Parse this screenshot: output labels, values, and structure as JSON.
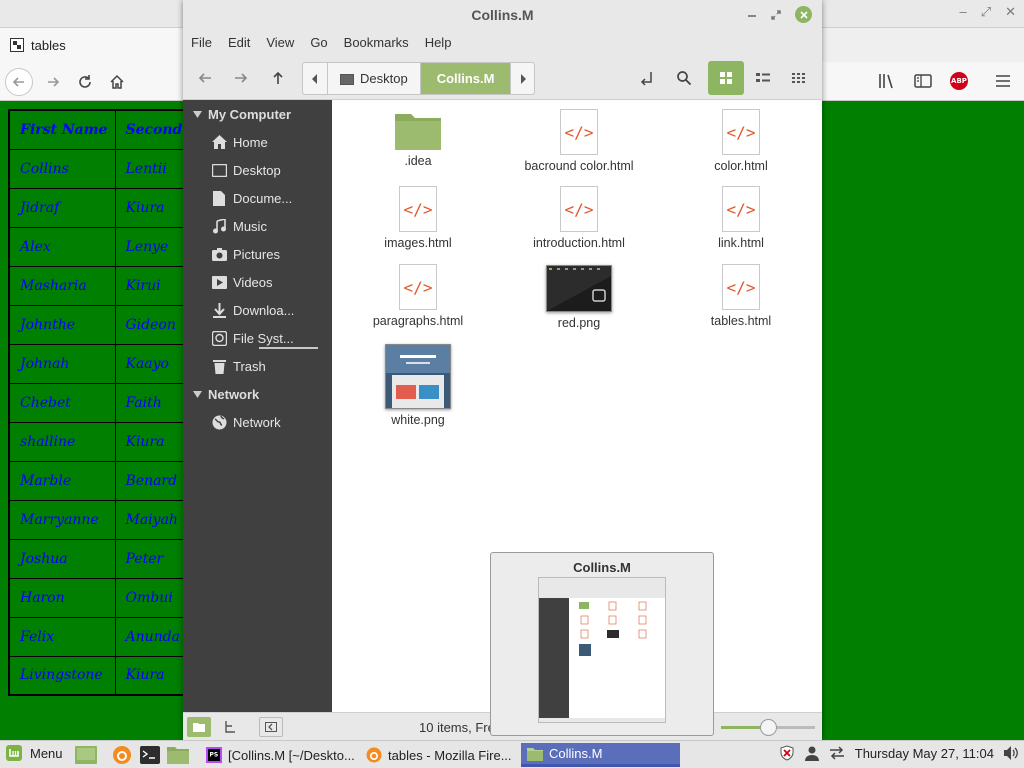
{
  "firefox": {
    "tab_title": "tables",
    "window_controls": [
      "–",
      "⤢",
      "✕"
    ],
    "table": {
      "headers": [
        "First Name",
        "Second"
      ],
      "rows": [
        [
          "Collins",
          "Lentii"
        ],
        [
          "Jidraf",
          "Kiura"
        ],
        [
          "Alex",
          "Lenye"
        ],
        [
          "Masharia",
          "Kirui"
        ],
        [
          "Johnthe",
          "Gideon"
        ],
        [
          "Johnah",
          "Kaayo"
        ],
        [
          "Chebet",
          "Faith"
        ],
        [
          "shalline",
          "Kiura"
        ],
        [
          "Marble",
          "Benard"
        ],
        [
          "Marryanne",
          "Maiyah"
        ],
        [
          "Joshua",
          "Peter"
        ],
        [
          "Haron",
          "Ombui"
        ],
        [
          "Felix",
          "Anunda"
        ],
        [
          "Livingstone",
          "Kiura"
        ]
      ]
    },
    "abp_label": "ABP",
    "page_bg": "#007f00",
    "text_color": "#0000ff"
  },
  "nemo": {
    "title": "Collins.M",
    "menu": [
      "File",
      "Edit",
      "View",
      "Go",
      "Bookmarks",
      "Help"
    ],
    "path": {
      "parent": "Desktop",
      "current": "Collins.M"
    },
    "sidebar": {
      "my_computer": "My Computer",
      "items": [
        {
          "label": "Home",
          "icon": "home-icon"
        },
        {
          "label": "Desktop",
          "icon": "desktop-icon"
        },
        {
          "label": "Docume...",
          "icon": "document-icon"
        },
        {
          "label": "Music",
          "icon": "music-icon"
        },
        {
          "label": "Pictures",
          "icon": "camera-icon"
        },
        {
          "label": "Videos",
          "icon": "video-icon"
        },
        {
          "label": "Downloa...",
          "icon": "download-icon"
        },
        {
          "label": "File Syst...",
          "icon": "drive-icon"
        },
        {
          "label": "Trash",
          "icon": "trash-icon"
        }
      ],
      "network_heading": "Network",
      "network_items": [
        {
          "label": "Network",
          "icon": "globe-icon"
        }
      ]
    },
    "files": [
      {
        "name": ".idea",
        "type": "folder"
      },
      {
        "name": "bacround color.html",
        "type": "html"
      },
      {
        "name": "color.html",
        "type": "html"
      },
      {
        "name": "images.html",
        "type": "html"
      },
      {
        "name": "introduction.html",
        "type": "html"
      },
      {
        "name": "link.html",
        "type": "html"
      },
      {
        "name": "paragraphs.html",
        "type": "html"
      },
      {
        "name": "red.png",
        "type": "image-dark"
      },
      {
        "name": "tables.html",
        "type": "html"
      },
      {
        "name": "white.png",
        "type": "image-web"
      }
    ],
    "html_glyph": "</>",
    "status": "10 items, Fre",
    "zoom_level": 0.5,
    "accent": "#8eb561"
  },
  "preview": {
    "title": "Collins.M"
  },
  "taskbar": {
    "menu_label": "Menu",
    "tasks": [
      {
        "label": "[Collins.M [~/Deskto...",
        "icon": "phpstorm-icon"
      },
      {
        "label": "tables - Mozilla Fire...",
        "icon": "firefox-icon"
      },
      {
        "label": "Collins.M",
        "icon": "folder-icon"
      }
    ],
    "clock": "Thursday May 27, 11:04",
    "ps_label": "PS"
  }
}
